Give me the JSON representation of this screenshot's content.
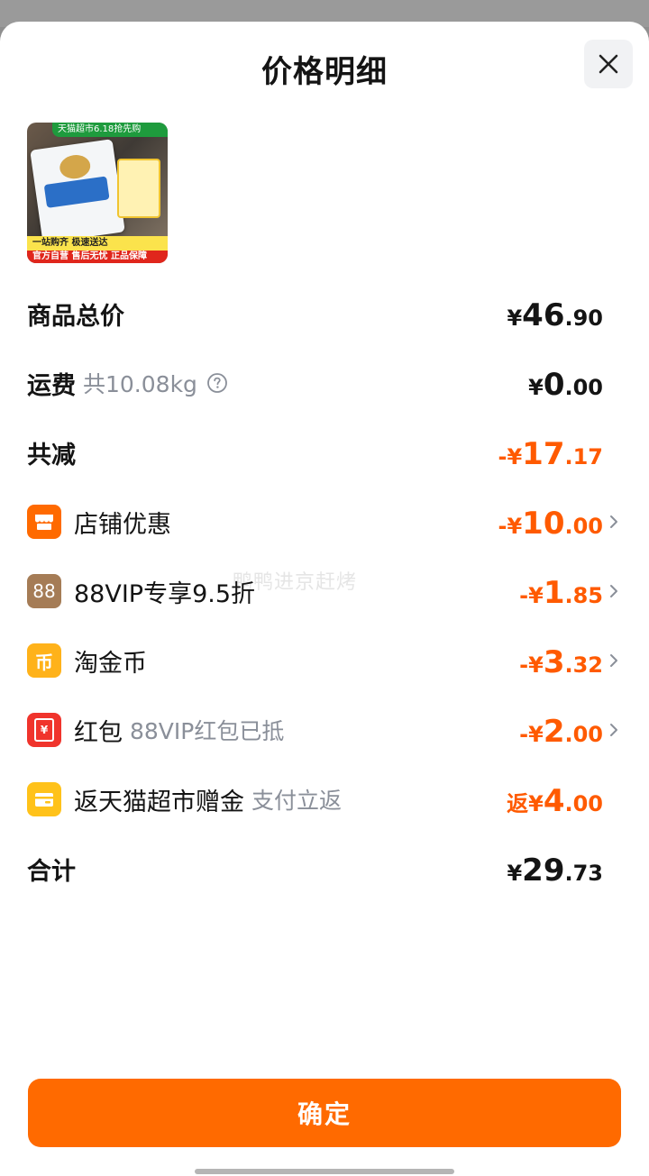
{
  "title": "价格明细",
  "product": {
    "banner": "天猫超市6.18抢先购",
    "strip1": "一站购齐 极速送达",
    "strip2": "官方自营 售后无忧 正品保障"
  },
  "rows": {
    "total_goods": {
      "label": "商品总价",
      "cur": "¥",
      "int": "46",
      "dec": ".90"
    },
    "shipping": {
      "label": "运费",
      "sub": "共10.08kg",
      "cur": "¥",
      "int": "0",
      "dec": ".00"
    },
    "discount_total": {
      "label": "共减",
      "pre": "-",
      "cur": "¥",
      "int": "17",
      "dec": ".17"
    },
    "store_discount": {
      "label": "店铺优惠",
      "pre": "-",
      "cur": "¥",
      "int": "10",
      "dec": ".00"
    },
    "vip": {
      "icon_text": "88",
      "label": "88VIP专享9.5折",
      "pre": "-",
      "cur": "¥",
      "int": "1",
      "dec": ".85"
    },
    "taojinbi": {
      "icon_text": "币",
      "label": "淘金币",
      "pre": "-",
      "cur": "¥",
      "int": "3",
      "dec": ".32"
    },
    "redpacket": {
      "icon_text": "¥",
      "label": "红包",
      "sub": "88VIP红包已抵",
      "pre": "-",
      "cur": "¥",
      "int": "2",
      "dec": ".00"
    },
    "cashback": {
      "label": "返天猫超市赠金",
      "sub": "支付立返",
      "pre": "返",
      "cur": "¥",
      "int": "4",
      "dec": ".00"
    },
    "grand_total": {
      "label": "合计",
      "cur": "¥",
      "int": "29",
      "dec": ".73"
    }
  },
  "watermark": "鸭鸭进京赶烤",
  "confirm_label": "确定",
  "colors": {
    "accent": "#ff6a00",
    "discount_text": "#ff5a00",
    "store_icon": "#ff6a00",
    "vip_icon": "#a57c56",
    "coin_icon": "#ffb21a",
    "redpacket_icon": "#f0342c",
    "cashback_icon": "#ffc21a"
  },
  "icons": {
    "close": "close-icon",
    "help": "question-circle-icon",
    "store": "store-icon",
    "vip": "vip88-icon",
    "coin": "coin-icon",
    "redpacket": "red-packet-icon",
    "cashback": "wallet-icon",
    "chevron": "chevron-right-icon"
  }
}
